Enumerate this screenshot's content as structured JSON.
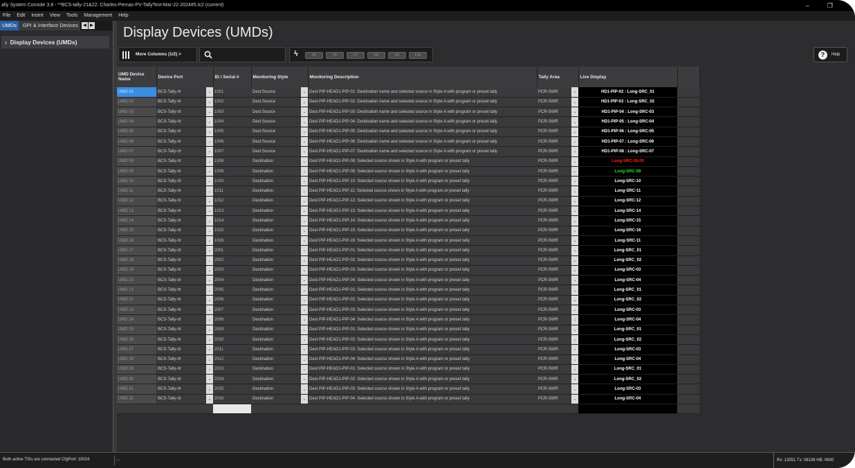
{
  "window": {
    "title": "ally System Console 3.8 - **BCS-tally-21&22: Charles-Pernas-PV-TallyTest-Mar-22-2024#5.tc2 (current)",
    "controls": [
      "–",
      "❐"
    ]
  },
  "menu": [
    "File",
    "Edit",
    "Insert",
    "View",
    "Tools",
    "Management",
    "Help"
  ],
  "left_panel": {
    "tabs": [
      "UMDs",
      "GPI & Interface Devices"
    ],
    "tree_item": "Display Devices (UMDs)"
  },
  "page_title": "Display Devices (UMDs)",
  "toolbar": {
    "more_columns": "More Columns (1/2) >",
    "search_placeholder": "",
    "function_keys": [
      "F5",
      "F6",
      "F7",
      "F8",
      "F9",
      "F10"
    ],
    "help": "Help"
  },
  "columns": [
    "UMD Device Name",
    "Device Port",
    "ID / Serial #",
    "Monitoring Style",
    "Monitoring Description",
    "Tally Area",
    "Live Display"
  ],
  "colors": {
    "selected_cell": "#3b8de0",
    "live_red": "#ff2020",
    "live_green": "#2ee02e",
    "background": "#2d2d30"
  },
  "rows": [
    {
      "name": "UMD 01",
      "port": "BCS-Tally-rtr",
      "id": "1001",
      "style": "Dest:Source",
      "desc": "Dest PIP-HEAD1-PIP-01: Destination name and selected source in Style A with program or preset tally",
      "tally": "PCR-SWR",
      "live": "HD1-PIP-02 : Long-SRC_01",
      "live_color": "white",
      "selected": true
    },
    {
      "name": "UMD 02",
      "port": "BCS-Tally-rtr",
      "id": "1002",
      "style": "Dest:Source",
      "desc": "Dest PIP-HEAD1-PIP-02: Destination name and selected source in Style A with program or preset tally",
      "tally": "PCR-SWR",
      "live": "HD1-PIP-03 : Long-SRC_02",
      "live_color": "white"
    },
    {
      "name": "UMD 03",
      "port": "BCS-Tally-rtr",
      "id": "1003",
      "style": "Dest:Source",
      "desc": "Dest PIP-HEAD1-PIP-03: Destination name and selected source in Style A with program or preset tally",
      "tally": "PCR-SWR",
      "live": "HD1-PIP-04 : Long-SRC-03",
      "live_color": "white"
    },
    {
      "name": "UMD 04",
      "port": "BCS-Tally-rtr",
      "id": "1004",
      "style": "Dest:Source",
      "desc": "Dest PIP-HEAD1-PIP-04: Destination name and selected source in Style A with program or preset tally",
      "tally": "PCR-SWR",
      "live": "HD1-PIP-05 : Long-SRC-04",
      "live_color": "white"
    },
    {
      "name": "UMD 05",
      "port": "BCS-Tally-rtr",
      "id": "1005",
      "style": "Dest:Source",
      "desc": "Dest PIP-HEAD1-PIP-05: Destination name and selected source in Style A with program or preset tally",
      "tally": "PCR-SWR",
      "live": "HD1-PIP-06 : Long-SRC-05",
      "live_color": "white"
    },
    {
      "name": "UMD 06",
      "port": "BCS-Tally-rtr",
      "id": "1006",
      "style": "Dest:Source",
      "desc": "Dest PIP-HEAD1-PIP-06: Destination name and selected source in Style A with program or preset tally",
      "tally": "PCR-SWR",
      "live": "HD1-PIP-07 : Long-SRC-06",
      "live_color": "white"
    },
    {
      "name": "UMD 07",
      "port": "BCS-Tally-rtr",
      "id": "1007",
      "style": "Dest:Source",
      "desc": "Dest PIP-HEAD1-PIP-07: Destination name and selected source in Style A with program or preset tally",
      "tally": "PCR-SWR",
      "live": "HD1-PIP-08 : Long-SRC-07",
      "live_color": "white"
    },
    {
      "name": "UMD 08",
      "port": "BCS-Tally-rtr",
      "id": "1008",
      "style": "Destination",
      "desc": "Dest PIP-HEAD1-PIP-08: Selected source shown in Style A with program or preset tally",
      "tally": "PCR-SWR",
      "live": "Long-SRC-08.00",
      "live_color": "red"
    },
    {
      "name": "UMD 09",
      "port": "BCS-Tally-rtr",
      "id": "1009",
      "style": "Destination",
      "desc": "Dest PIP-HEAD1-PIP-09: Selected source shown in Style A with program or preset tally",
      "tally": "PCR-SWR",
      "live": "Long-SRC-09",
      "live_color": "green"
    },
    {
      "name": "UMD 10",
      "port": "BCS-Tally-rtr",
      "id": "1010",
      "style": "Destination",
      "desc": "Dest PIP-HEAD1-PIP-10: Selected source shown in Style A with program or preset tally",
      "tally": "PCR-SWR",
      "live": "Long-SRC-10",
      "live_color": "white"
    },
    {
      "name": "UMD 11",
      "port": "BCS-Tally-rtr",
      "id": "1011",
      "style": "Destination",
      "desc": "Dest PIP-HEAD1-PIP-11: Selected source shown in Style A with program or preset tally",
      "tally": "PCR-SWR",
      "live": "Long-SRC-11",
      "live_color": "white"
    },
    {
      "name": "UMD 12",
      "port": "BCS-Tally-rtr",
      "id": "1012",
      "style": "Destination",
      "desc": "Dest PIP-HEAD1-PIP-12: Selected source shown in Style A with program or preset tally",
      "tally": "PCR-SWR",
      "live": "Long-SRC-12",
      "live_color": "white"
    },
    {
      "name": "UMD 13",
      "port": "BCS-Tally-rtr",
      "id": "1013",
      "style": "Destination",
      "desc": "Dest PIP-HEAD1-PIP-13: Selected source shown in Style A with program or preset tally",
      "tally": "PCR-SWR",
      "live": "Long-SRC-14",
      "live_color": "white"
    },
    {
      "name": "UMD 14",
      "port": "BCS-Tally-rtr",
      "id": "1014",
      "style": "Destination",
      "desc": "Dest PIP-HEAD1-PIP-14: Selected source shown in Style A with program or preset tally",
      "tally": "PCR-SWR",
      "live": "Long-SRC-15",
      "live_color": "white"
    },
    {
      "name": "UMD 15",
      "port": "BCS-Tally-rtr",
      "id": "1015",
      "style": "Destination",
      "desc": "Dest PIP-HEAD1-PIP-15: Selected source shown in Style A with program or preset tally",
      "tally": "PCR-SWR",
      "live": "Long-SRC-16",
      "live_color": "white"
    },
    {
      "name": "UMD 16",
      "port": "BCS-Tally-rtr",
      "id": "1016",
      "style": "Destination",
      "desc": "Dest PIP-HEAD1-PIP-16: Selected source shown in Style A with program or preset tally",
      "tally": "PCR-SWR",
      "live": "Long-SRC-11",
      "live_color": "white"
    },
    {
      "name": "UMD 17",
      "port": "BCS-Tally-rtr",
      "id": "2001",
      "style": "Destination",
      "desc": "Dest PIP-HEAD1-PIP-01: Selected source shown in Style A with program or preset tally",
      "tally": "PCR-SWR",
      "live": "Long-SRC_01",
      "live_color": "white"
    },
    {
      "name": "UMD 18",
      "port": "BCS-Tally-rtr",
      "id": "2002",
      "style": "Destination",
      "desc": "Dest PIP-HEAD1-PIP-02: Selected source shown in Style A with program or preset tally",
      "tally": "PCR-SWR",
      "live": "Long-SRC_02",
      "live_color": "white"
    },
    {
      "name": "UMD 19",
      "port": "BCS-Tally-rtr",
      "id": "2003",
      "style": "Destination",
      "desc": "Dest PIP-HEAD1-PIP-03: Selected source shown in Style A with program or preset tally",
      "tally": "PCR-SWR",
      "live": "Long-SRC-03",
      "live_color": "white"
    },
    {
      "name": "UMD 20",
      "port": "BCS-Tally-rtr",
      "id": "2004",
      "style": "Destination",
      "desc": "Dest PIP-HEAD1-PIP-04: Selected source shown in Style A with program or preset tally",
      "tally": "PCR-SWR",
      "live": "Long-SRC-04",
      "live_color": "white"
    },
    {
      "name": "UMD 21",
      "port": "BCS-Tally-rtr",
      "id": "2005",
      "style": "Destination",
      "desc": "Dest PIP-HEAD1-PIP-01: Selected source shown in Style A with program or preset tally",
      "tally": "PCR-SWR",
      "live": "Long-SRC_01",
      "live_color": "white"
    },
    {
      "name": "UMD 22",
      "port": "BCS-Tally-rtr",
      "id": "2006",
      "style": "Destination",
      "desc": "Dest PIP-HEAD1-PIP-02: Selected source shown in Style A with program or preset tally",
      "tally": "PCR-SWR",
      "live": "Long-SRC_02",
      "live_color": "white"
    },
    {
      "name": "UMD 23",
      "port": "BCS-Tally-rtr",
      "id": "2007",
      "style": "Destination",
      "desc": "Dest PIP-HEAD1-PIP-03: Selected source shown in Style A with program or preset tally",
      "tally": "PCR-SWR",
      "live": "Long-SRC-03",
      "live_color": "white"
    },
    {
      "name": "UMD 24",
      "port": "BCS-Tally-rtr",
      "id": "2008",
      "style": "Destination",
      "desc": "Dest PIP-HEAD1-PIP-04: Selected source shown in Style A with program or preset tally",
      "tally": "PCR-SWR",
      "live": "Long-SRC-04",
      "live_color": "white"
    },
    {
      "name": "UMD 25",
      "port": "BCS-Tally-rtr",
      "id": "2009",
      "style": "Destination",
      "desc": "Dest PIP-HEAD1-PIP-01: Selected source shown in Style A with program or preset tally",
      "tally": "PCR-SWR",
      "live": "Long-SRC_01",
      "live_color": "white"
    },
    {
      "name": "UMD 26",
      "port": "BCS-Tally-rtr",
      "id": "2010",
      "style": "Destination",
      "desc": "Dest PIP-HEAD1-PIP-02: Selected source shown in Style A with program or preset tally",
      "tally": "PCR-SWR",
      "live": "Long-SRC_02",
      "live_color": "white"
    },
    {
      "name": "UMD 27",
      "port": "BCS-Tally-rtr",
      "id": "2011",
      "style": "Destination",
      "desc": "Dest PIP-HEAD1-PIP-03: Selected source shown in Style A with program or preset tally",
      "tally": "PCR-SWR",
      "live": "Long-SRC-03",
      "live_color": "white"
    },
    {
      "name": "UMD 28",
      "port": "BCS-Tally-rtr",
      "id": "2012",
      "style": "Destination",
      "desc": "Dest PIP-HEAD1-PIP-04: Selected source shown in Style A with program or preset tally",
      "tally": "PCR-SWR",
      "live": "Long-SRC-04",
      "live_color": "white"
    },
    {
      "name": "UMD 29",
      "port": "BCS-Tally-rtr",
      "id": "2013",
      "style": "Destination",
      "desc": "Dest PIP-HEAD1-PIP-01: Selected source shown in Style A with program or preset tally",
      "tally": "PCR-SWR",
      "live": "Long-SRC_01",
      "live_color": "white"
    },
    {
      "name": "UMD 30",
      "port": "BCS-Tally-rtr",
      "id": "2014",
      "style": "Destination",
      "desc": "Dest PIP-HEAD1-PIP-02: Selected source shown in Style A with program or preset tally",
      "tally": "PCR-SWR",
      "live": "Long-SRC_02",
      "live_color": "white"
    },
    {
      "name": "UMD 31",
      "port": "BCS-Tally-rtr",
      "id": "2015",
      "style": "Destination",
      "desc": "Dest PIP-HEAD1-PIP-03: Selected source shown in Style A with program or preset tally",
      "tally": "PCR-SWR",
      "live": "Long-SRC-03",
      "live_color": "white"
    },
    {
      "name": "UMD 32",
      "port": "BCS-Tally-rtr",
      "id": "2016",
      "style": "Destination",
      "desc": "Dest PIP-HEAD1-PIP-04: Selected source shown in Style A with program or preset tally",
      "tally": "PCR-SWR",
      "live": "Long-SRC-04",
      "live_color": "white"
    }
  ],
  "status": {
    "left": "Both active TSIs are connected CfgPort: 10024",
    "middle": "...",
    "right": "Rx: 13551  Tx: 08138  HB: 0600"
  }
}
